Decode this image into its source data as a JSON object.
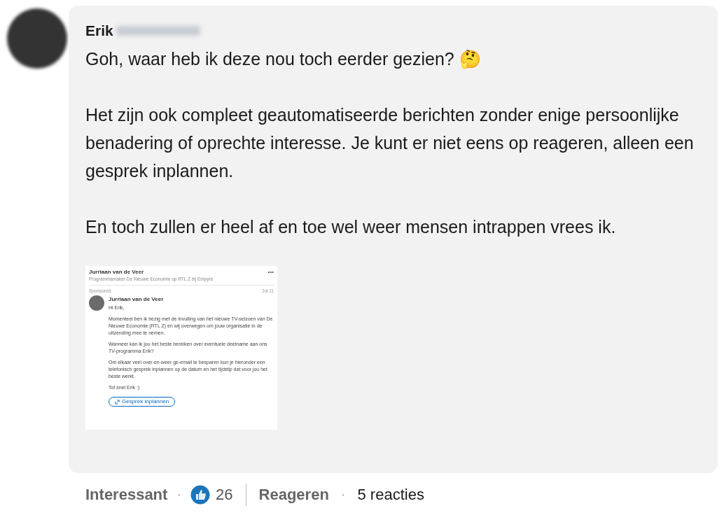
{
  "comment": {
    "author": "Erik",
    "paragraphs": [
      "Goh, waar heb ik deze nou toch eerder gezien? 🤔",
      "Het zijn ook compleet geautomatiseerde berichten zonder enige persoonlijke benadering of oprechte interesse. Je kunt er niet eens op reageren, alleen een gesprek inplannen.",
      "En toch zullen er heel af en toe wel weer mensen intrappen vrees ik."
    ]
  },
  "attachment": {
    "poster": "Jurriaan van de Veer",
    "headline": "Programmamaker De Nieuwe Economie op RTL Z bij Empyre",
    "more": "•••",
    "sponsored": "Sponsored",
    "date": "Jul 11",
    "sender": "Jurriaan van de Veer",
    "message": [
      "Hi Erik,",
      "Momenteel ben ik bezig met de invulling van het nieuwe TV-seizoen van De Nieuwe Economie (RTL Z) en wij overwegen om jouw organisatie in de uitzending mee te nemen.",
      "Wanneer kan ik jou het beste bereiken over eventuele deelname aan ons TV-programma Erik?",
      "Om elkaar veel over-en-weer ge-email te besparen kun je hieronder een telefonisch gesprek inplannen op de datum en het tijdstip dat voor jou het beste werkt.",
      "Tot snel Erik :)"
    ],
    "button": "Gesprek inplannen"
  },
  "footer": {
    "reaction": "Interessant",
    "separator_1": "·",
    "count": "26",
    "reply": "Reageren",
    "separator_2": "·",
    "replies": "5 reacties"
  }
}
